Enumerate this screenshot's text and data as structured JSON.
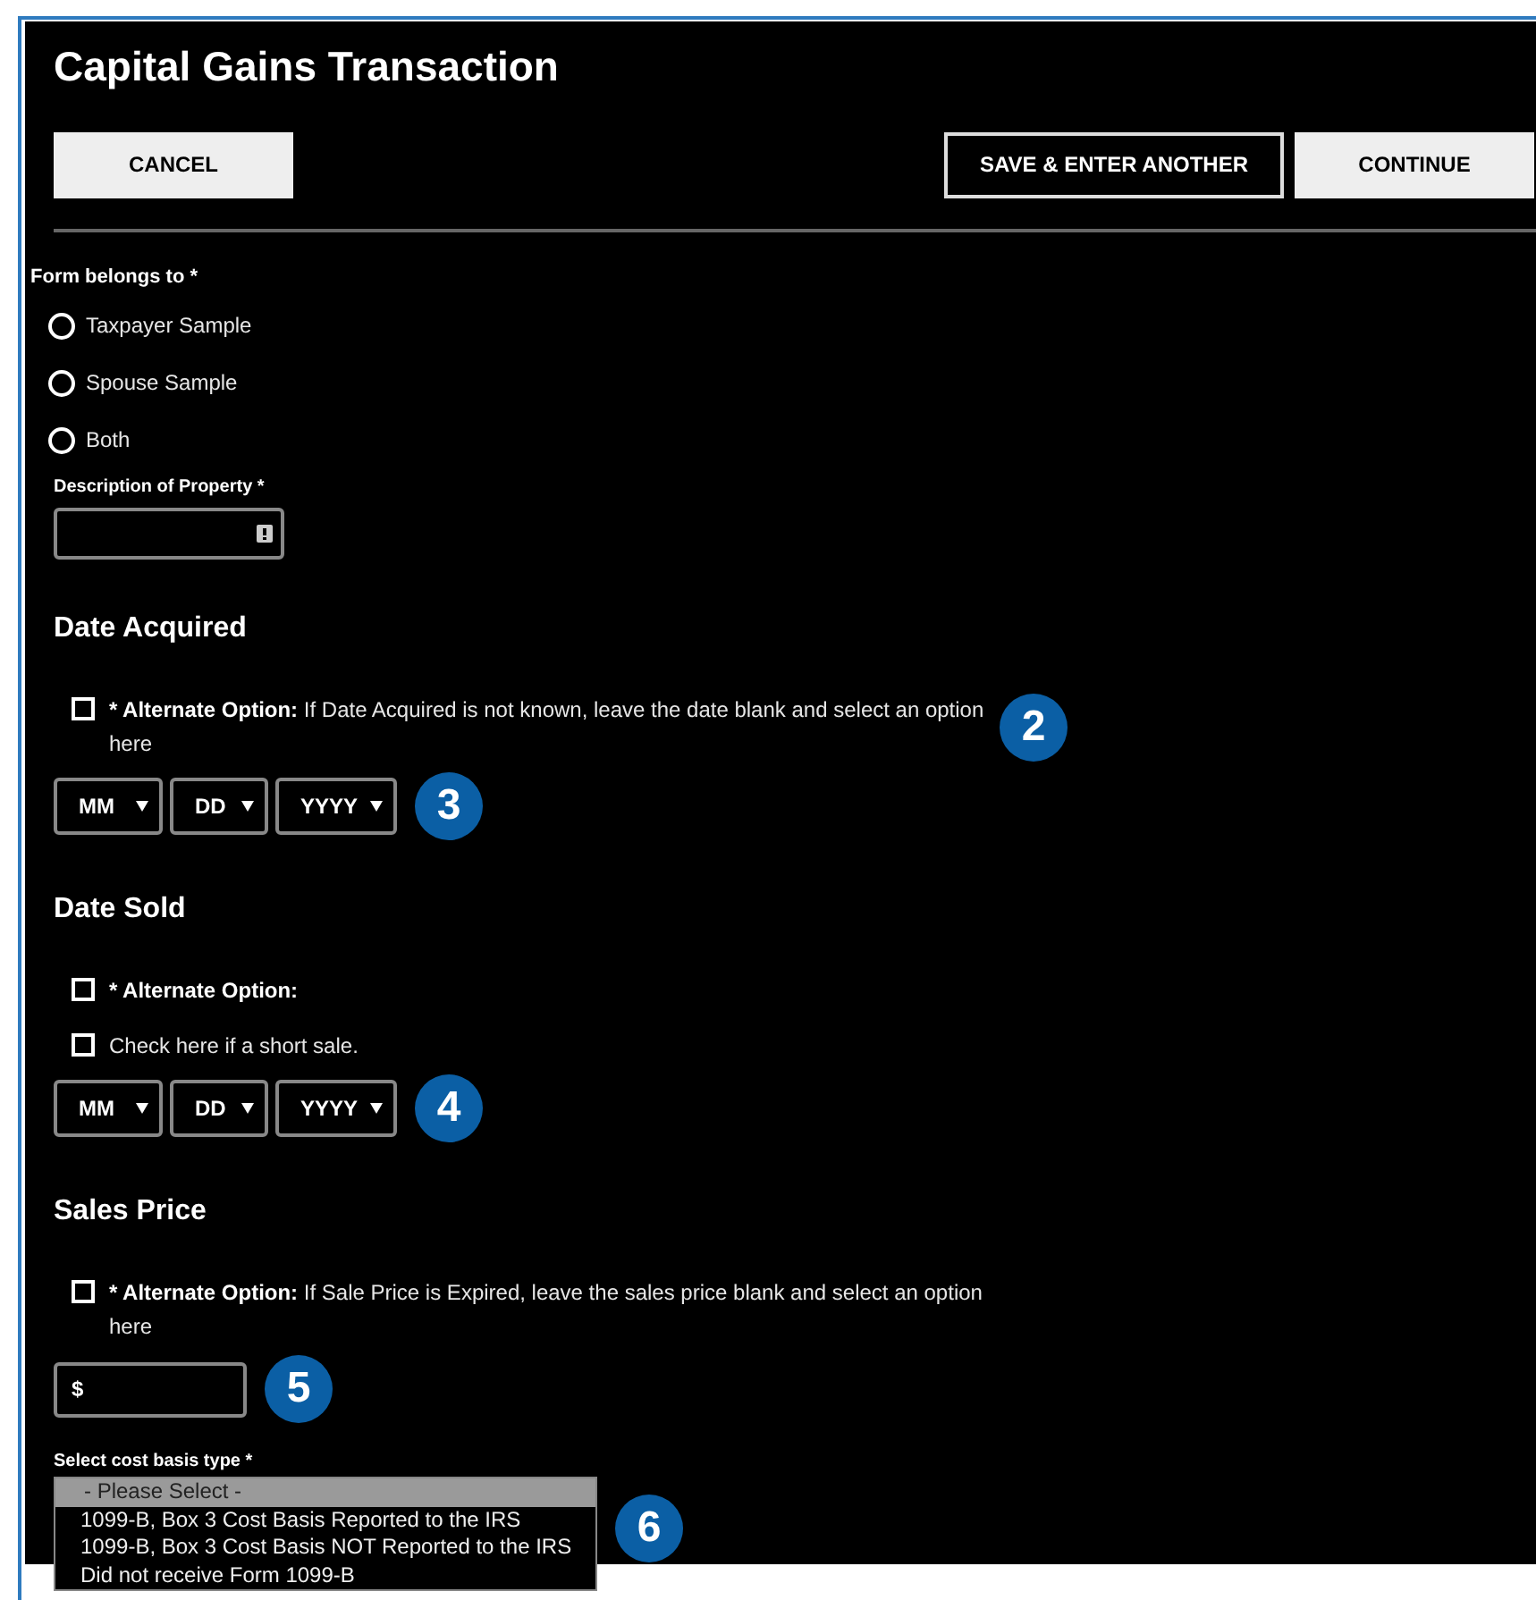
{
  "title": "Capital Gains Transaction",
  "left_buttons": [
    {
      "label": "CANCEL",
      "kind": "filled"
    }
  ],
  "right_buttons": [
    {
      "label": "SAVE & ENTER ANOTHER",
      "kind": "outlined"
    },
    {
      "label": "CONTINUE",
      "kind": "filled"
    }
  ],
  "owner": {
    "label": "Form belongs to *",
    "options": [
      {
        "label": "Taxpayer Sample",
        "selected": false
      },
      {
        "label": "Spouse Sample",
        "selected": false
      },
      {
        "label": "Both",
        "selected": false
      }
    ]
  },
  "description": {
    "label": "Description of Property *"
  },
  "sections": [
    {
      "heading": "Date Acquired",
      "checks": [
        {
          "prefix": "* Alternate Option:",
          "text": "If Date Acquired is not known, leave the date blank and select an option here",
          "checked": false,
          "callout": "2"
        }
      ],
      "input": {
        "kind": "date",
        "selects": [
          "MM",
          "DD",
          "YYYY"
        ],
        "callout": "3"
      }
    },
    {
      "heading": "Date Sold",
      "checks": [
        {
          "prefix": "* Alternate Option:",
          "checked": false
        },
        {
          "text": "Check here if a short sale.",
          "checked": false
        }
      ],
      "input": {
        "kind": "date",
        "selects": [
          "MM",
          "DD",
          "YYYY"
        ],
        "callout": "4"
      }
    },
    {
      "heading": "Sales Price",
      "checks": [
        {
          "prefix": "* Alternate Option:",
          "text": "If Sale Price is Expired, leave the sales price blank and select an option here",
          "checked": false
        }
      ],
      "input": {
        "kind": "money",
        "prefix": "$",
        "callout": "5"
      }
    }
  ],
  "cost_basis": {
    "label": "Select cost basis type *",
    "callout": "6",
    "options": [
      {
        "label": "- Please Select -",
        "selected": true
      },
      {
        "label": "1099-B, Box 3 Cost Basis Reported to the IRS",
        "selected": false
      },
      {
        "label": "1099-B, Box 3 Cost Basis NOT Reported to the IRS",
        "selected": false
      },
      {
        "label": "Did not receive Form 1099-B",
        "selected": false
      }
    ]
  }
}
